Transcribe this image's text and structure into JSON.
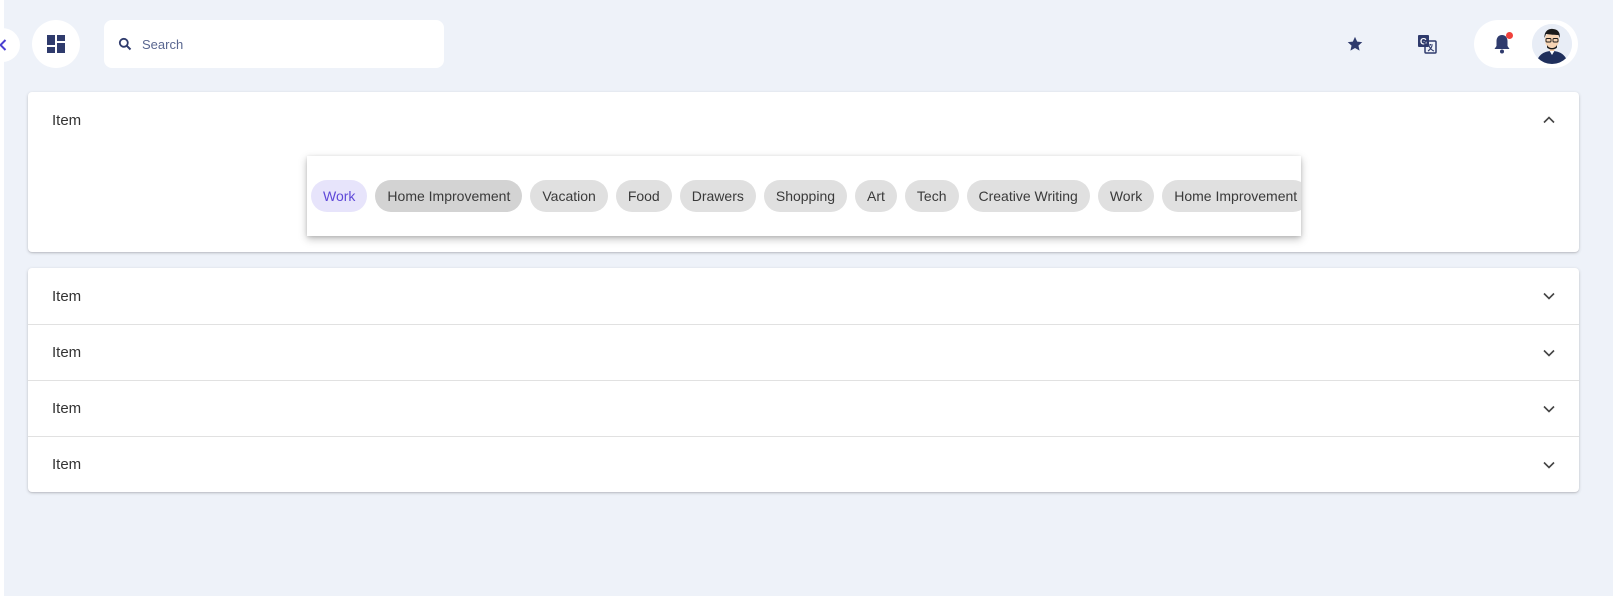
{
  "header": {
    "search": {
      "placeholder": "Search",
      "value": ""
    },
    "icons": {
      "collapse": "chevron-left-icon",
      "logo": "dashboard-icon",
      "favorites": "star-icon",
      "translate": "translate-icon",
      "notifications": "bell-icon"
    },
    "notification_badge": true
  },
  "accordion": {
    "expanded_item": {
      "label": "Item",
      "expanded": true
    },
    "items": [
      {
        "label": "Item",
        "expanded": false
      },
      {
        "label": "Item",
        "expanded": false
      },
      {
        "label": "Item",
        "expanded": false
      },
      {
        "label": "Item",
        "expanded": false
      }
    ]
  },
  "chips": [
    {
      "label": "Work",
      "state": "selected"
    },
    {
      "label": "Home Improvement",
      "state": "hovered"
    },
    {
      "label": "Vacation",
      "state": "default"
    },
    {
      "label": "Food",
      "state": "default"
    },
    {
      "label": "Drawers",
      "state": "default"
    },
    {
      "label": "Shopping",
      "state": "default"
    },
    {
      "label": "Art",
      "state": "default"
    },
    {
      "label": "Tech",
      "state": "default"
    },
    {
      "label": "Creative Writing",
      "state": "default"
    },
    {
      "label": "Work",
      "state": "default"
    },
    {
      "label": "Home Improvement",
      "state": "default"
    }
  ],
  "colors": {
    "background": "#eef2f9",
    "accent": "#5f49d8",
    "icon": "#2f3b6d",
    "badge": "#f0413c"
  }
}
